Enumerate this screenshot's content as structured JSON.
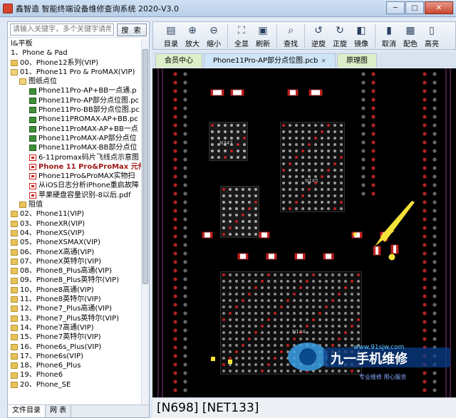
{
  "window": {
    "title": "鑫智造 智能终端设备维修查询系统 2020-V3.0",
    "minimize": "─",
    "maximize": "□",
    "close": "✕"
  },
  "search": {
    "placeholder": "请输入关键字，多个关键字请用",
    "button": "搜 索"
  },
  "tree": {
    "items": [
      {
        "label": "l&平板",
        "icon": "none",
        "style": ""
      },
      {
        "label": "1、Phone & Pad",
        "icon": "none",
        "style": ""
      },
      {
        "label": "00、Phone12系列(VIP)",
        "icon": "folder",
        "style": ""
      },
      {
        "label": "01、Phone11 Pro & ProMAX(VIP)",
        "icon": "folder-open",
        "style": ""
      },
      {
        "label": "图纸点位",
        "icon": "folder-open",
        "style": ""
      },
      {
        "label": "Phone11Pro-AP+BB一点通.p",
        "icon": "pcb",
        "style": ""
      },
      {
        "label": "Phone11Pro-AP部分点位图.pc",
        "icon": "pcb",
        "style": ""
      },
      {
        "label": "Phone11Pro-BB部分点位图.pc",
        "icon": "pcb",
        "style": ""
      },
      {
        "label": "Phone11PROMAX-AP+BB.pc",
        "icon": "pcb",
        "style": ""
      },
      {
        "label": "Phone11ProMAX-AP+BB一点",
        "icon": "pcb",
        "style": ""
      },
      {
        "label": "Phone11ProMAX-AP部分点位",
        "icon": "pcb",
        "style": ""
      },
      {
        "label": "Phone11ProMAX-BB部分点位",
        "icon": "pcb",
        "style": ""
      },
      {
        "label": "6-11promax码片飞线点示意图",
        "icon": "pdf",
        "style": ""
      },
      {
        "label": "Phone 11 Pro&ProMax 元件",
        "icon": "pdf",
        "style": "bold"
      },
      {
        "label": "Phone11Pro&ProMAX实物扫",
        "icon": "pdf",
        "style": ""
      },
      {
        "label": "从iOS日志分析iPhone重启故障",
        "icon": "pdf",
        "style": ""
      },
      {
        "label": "苹果硬盘容量识别-8以后.pdf",
        "icon": "pdf",
        "style": ""
      },
      {
        "label": "阻值",
        "icon": "folder",
        "style": ""
      },
      {
        "label": "02、Phone11(VIP)",
        "icon": "folder",
        "style": ""
      },
      {
        "label": "03、PhoneXR(VIP)",
        "icon": "folder",
        "style": ""
      },
      {
        "label": "04、PhoneXS(VIP)",
        "icon": "folder",
        "style": ""
      },
      {
        "label": "05、PhoneXSMAX(VIP)",
        "icon": "folder",
        "style": ""
      },
      {
        "label": "06、PhoneX高通(VIP)",
        "icon": "folder",
        "style": ""
      },
      {
        "label": "07、PhoneX英特尔(VIP)",
        "icon": "folder",
        "style": ""
      },
      {
        "label": "08、Phone8_Plus高通(VIP)",
        "icon": "folder",
        "style": ""
      },
      {
        "label": "09、Phone8_Plus英特尔(VIP)",
        "icon": "folder",
        "style": ""
      },
      {
        "label": "10、Phone8高通(VIP)",
        "icon": "folder",
        "style": ""
      },
      {
        "label": "11、Phone8英特尔(VIP)",
        "icon": "folder",
        "style": ""
      },
      {
        "label": "12、Phone7_Plus高通(VIP)",
        "icon": "folder",
        "style": ""
      },
      {
        "label": "13、Phone7_Plus英特尔(VIP)",
        "icon": "folder",
        "style": ""
      },
      {
        "label": "14、Phone7高通(VIP)",
        "icon": "folder",
        "style": ""
      },
      {
        "label": "15、Phone7英特尔(VIP)",
        "icon": "folder",
        "style": ""
      },
      {
        "label": "16、Phone6s_Plus(VIP)",
        "icon": "folder",
        "style": ""
      },
      {
        "label": "17、Phone6s(VIP)",
        "icon": "folder",
        "style": ""
      },
      {
        "label": "18、Phone6_Plus",
        "icon": "folder",
        "style": ""
      },
      {
        "label": "19、Phone6",
        "icon": "folder",
        "style": ""
      },
      {
        "label": "20、Phone_SE",
        "icon": "folder",
        "style": ""
      }
    ]
  },
  "left_tabs": [
    "文件目录",
    "网 表"
  ],
  "toolbar": {
    "buttons": [
      {
        "label": "目录",
        "icon": "catalog-icon",
        "glyph": "▤"
      },
      {
        "label": "放大",
        "icon": "zoom-in-icon",
        "glyph": "⊕"
      },
      {
        "label": "缩小",
        "icon": "zoom-out-icon",
        "glyph": "⊖"
      },
      {
        "label": "全显",
        "icon": "fit-all-icon",
        "glyph": "⛶"
      },
      {
        "label": "刷新",
        "icon": "refresh-icon",
        "glyph": "▣"
      },
      {
        "label": "查找",
        "icon": "find-icon",
        "glyph": "⌕"
      },
      {
        "label": "逆旋",
        "icon": "rotate-ccw-icon",
        "glyph": "↺"
      },
      {
        "label": "正旋",
        "icon": "rotate-cw-icon",
        "glyph": "↻"
      },
      {
        "label": "镜像",
        "icon": "mirror-icon",
        "glyph": "◧"
      },
      {
        "label": "取消",
        "icon": "cancel-icon",
        "glyph": "▮"
      },
      {
        "label": "配色",
        "icon": "color-scheme-icon",
        "glyph": "▦"
      },
      {
        "label": "高亮",
        "icon": "highlight-icon",
        "glyph": "▯"
      }
    ]
  },
  "doc_tabs": [
    {
      "label": "会员中心",
      "color": "green"
    },
    {
      "label": "Phone11Pro-AP部分点位图.pcb",
      "color": "blue",
      "closable": true
    },
    {
      "label": "原理图",
      "color": "green"
    }
  ],
  "board": {
    "labels": [
      "N347",
      "N145",
      "N144"
    ],
    "watermark": {
      "url": "www.91sjw.com",
      "brand": "九一手机维修",
      "slogan": "专业维修 用心服务"
    }
  },
  "status": {
    "text": "[N698] [NET133]"
  }
}
